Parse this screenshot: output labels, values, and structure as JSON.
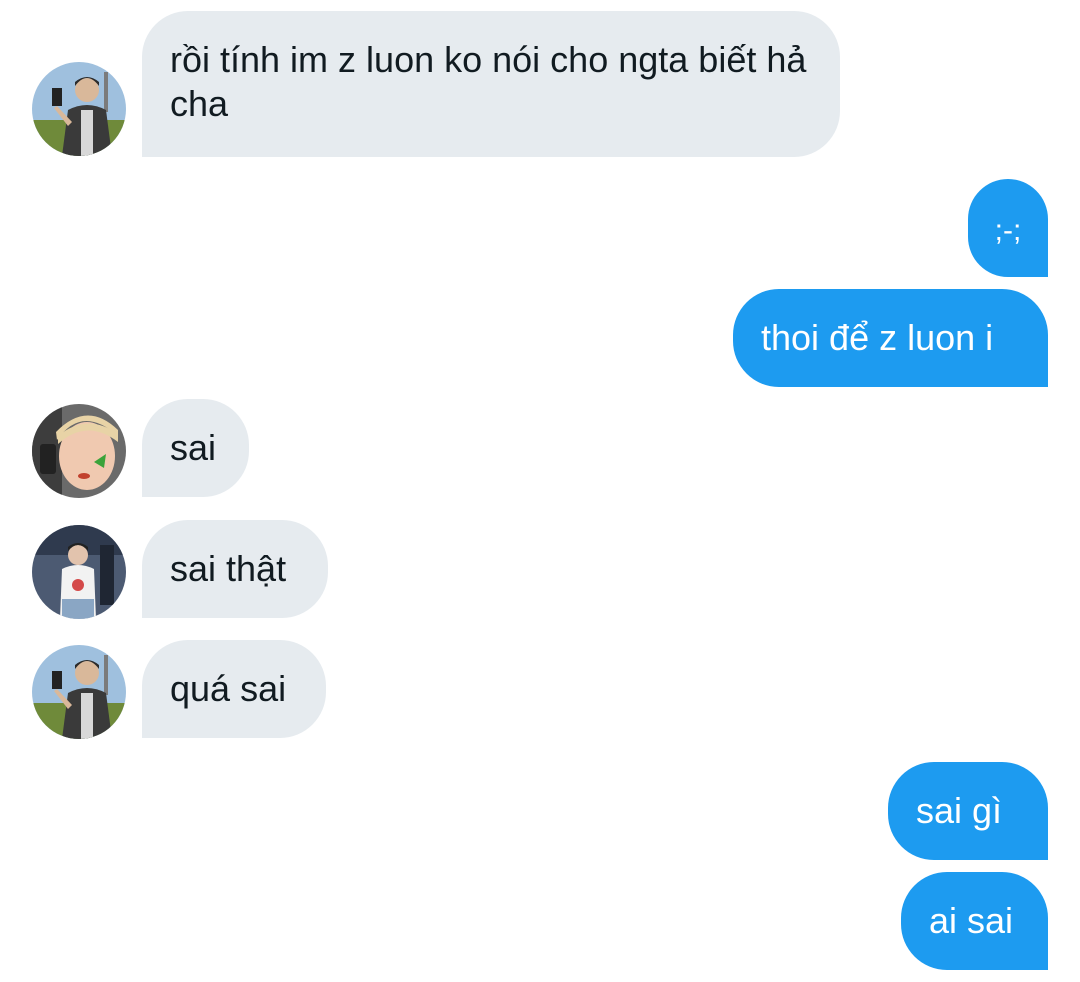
{
  "conversation": {
    "messages": [
      {
        "direction": "incoming",
        "avatar": "avatar-1",
        "text": "rồi tính im z luon ko nói cho ngta biết hả cha"
      },
      {
        "direction": "outgoing",
        "text": ";-;"
      },
      {
        "direction": "outgoing",
        "text": "thoi để z luon i"
      },
      {
        "direction": "incoming",
        "avatar": "avatar-2",
        "text": "sai"
      },
      {
        "direction": "incoming",
        "avatar": "avatar-3",
        "text": "sai thật"
      },
      {
        "direction": "incoming",
        "avatar": "avatar-1",
        "text": "quá sai"
      },
      {
        "direction": "outgoing",
        "text": "sai gì"
      },
      {
        "direction": "outgoing",
        "text": "ai sai"
      }
    ]
  },
  "colors": {
    "incoming_bubble": "#e6ebef",
    "outgoing_bubble": "#1d9bf0",
    "incoming_text": "#111b21",
    "outgoing_text": "#ffffff",
    "background": "#ffffff"
  },
  "icons": [
    "avatar-1",
    "avatar-2",
    "avatar-3"
  ]
}
